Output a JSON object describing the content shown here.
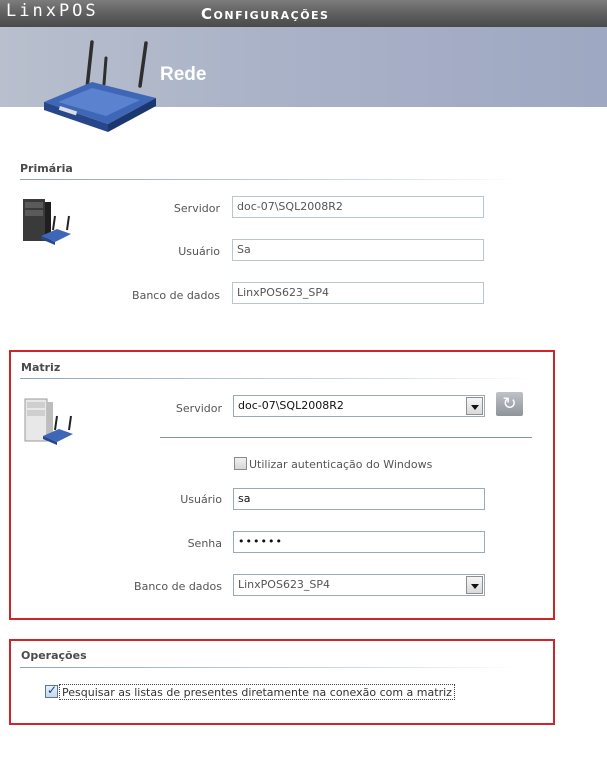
{
  "app": {
    "brand": "LinxPOS",
    "window_title": "Configurações"
  },
  "header": {
    "title": "Rede",
    "icon": "wireless-router-icon"
  },
  "primaria": {
    "title": "Primária",
    "icon": "server-router-icon",
    "servidor_label": "Servidor",
    "servidor_value": "doc-07\\SQL2008R2",
    "usuario_label": "Usuário",
    "usuario_value": "Sa",
    "banco_label": "Banco de dados",
    "banco_value": "LinxPOS623_SP4"
  },
  "matriz": {
    "title": "Matriz",
    "icon": "server-router-icon",
    "servidor_label": "Servidor",
    "servidor_value": "doc-07\\SQL2008R2",
    "refresh_icon": "refresh-icon",
    "windows_auth_label": "Utilizar autenticação do Windows",
    "windows_auth_checked": false,
    "usuario_label": "Usuário",
    "usuario_value": "sa",
    "senha_label": "Senha",
    "senha_value": "••••••",
    "banco_label": "Banco de dados",
    "banco_value": "LinxPOS623_SP4"
  },
  "operacoes": {
    "title": "Operações",
    "pesquisar_label": "Pesquisar as listas de presentes diretamente na conexão com a matriz",
    "pesquisar_checked": true
  },
  "colors": {
    "highlight_border": "#d0242b",
    "header_band": "#aab2c8",
    "title_bar": "#5d5d5d"
  }
}
